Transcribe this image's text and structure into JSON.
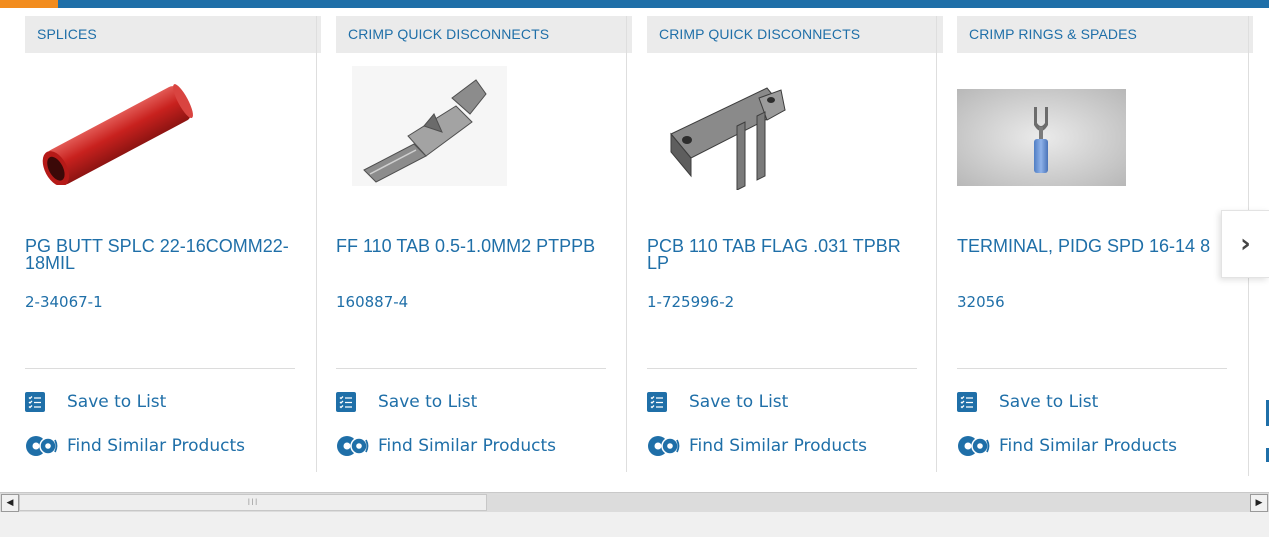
{
  "colors": {
    "brand_blue": "#1f6fa8",
    "accent_orange": "#f28c1e",
    "category_bg": "#ebebeb"
  },
  "products": [
    {
      "category": "SPLICES",
      "title": "PG BUTT SPLC 22-16COMM22-18MIL",
      "part_number": "2-34067-1",
      "save_label": "Save to List",
      "similar_label": "Find Similar Products",
      "image": "red-butt-splice"
    },
    {
      "category": "CRIMP QUICK DISCONNECTS",
      "title": "FF 110 TAB 0.5-1.0MM2 PTPPB",
      "part_number": "160887-4",
      "save_label": "Save to List",
      "similar_label": "Find Similar Products",
      "image": "crimp-tab-terminal"
    },
    {
      "category": "CRIMP QUICK DISCONNECTS",
      "title": "PCB 110 TAB FLAG .031 TPBR LP",
      "part_number": "1-725996-2",
      "save_label": "Save to List",
      "similar_label": "Find Similar Products",
      "image": "pcb-flag-tab"
    },
    {
      "category": "CRIMP RINGS & SPADES",
      "title": "TERMINAL, PIDG SPD 16-14 8",
      "part_number": "32056",
      "save_label": "Save to List",
      "similar_label": "Find Similar Products",
      "image": "spade-terminal"
    }
  ],
  "carousel": {
    "next_icon": "chevron-right-icon",
    "next_glyph": "›"
  },
  "scrollbar": {
    "left_arrow": "◀",
    "right_arrow": "▶",
    "grip": "III"
  }
}
